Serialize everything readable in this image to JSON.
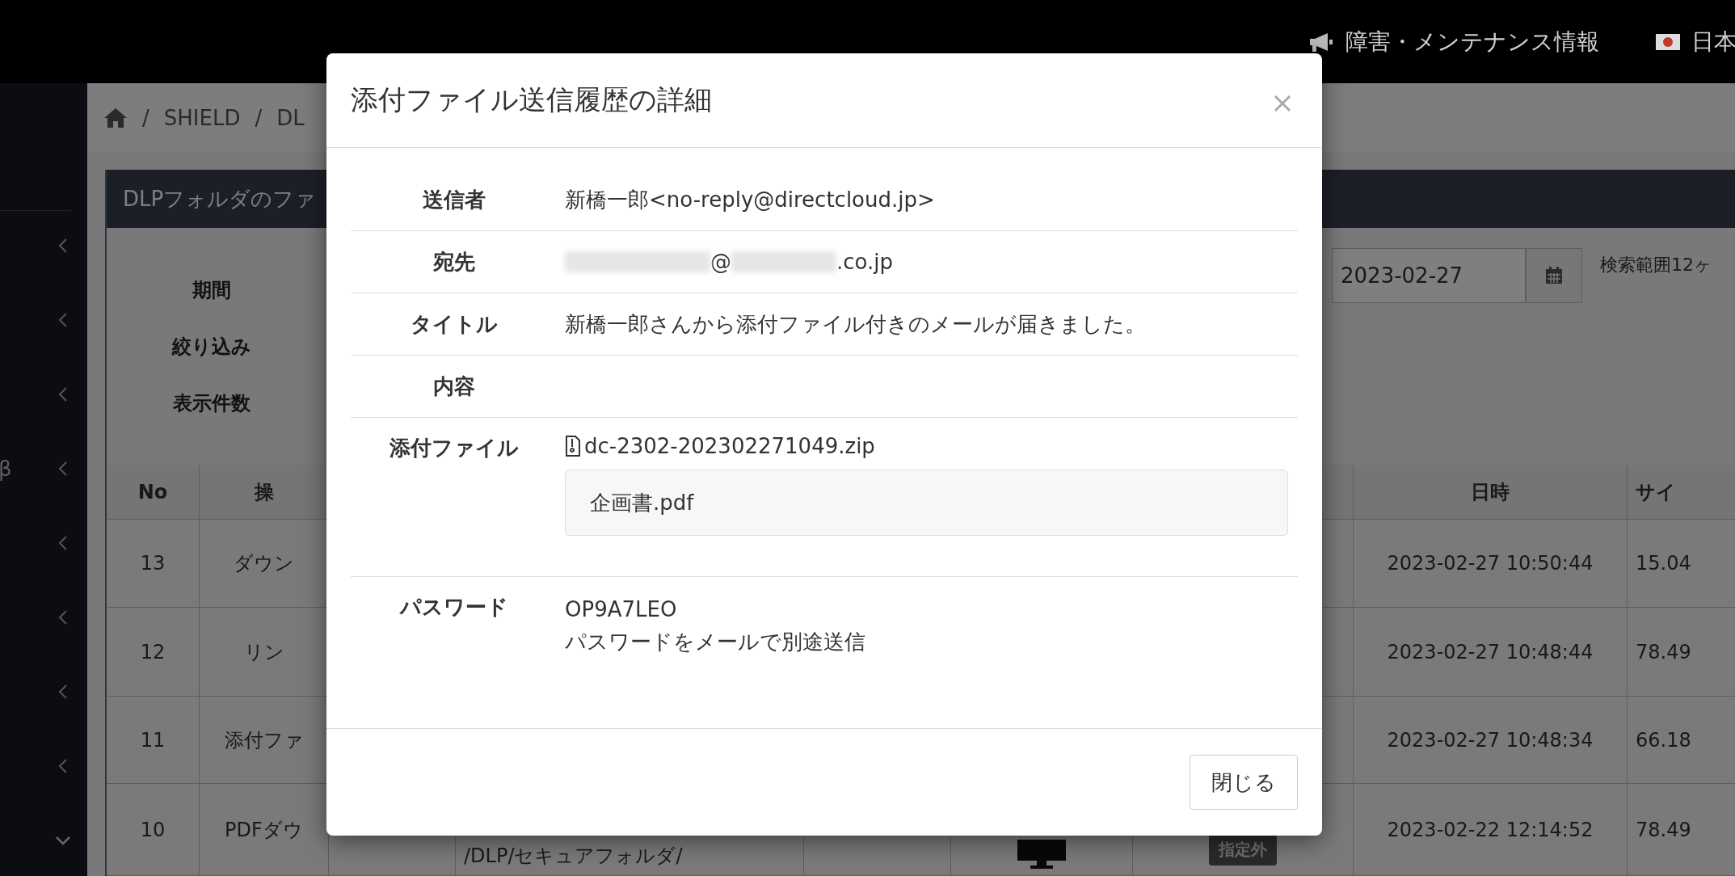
{
  "top_bar": {
    "notice_link": "障害・メンテナンス情報",
    "language": "日本"
  },
  "sidebar": {
    "beta_label": "β"
  },
  "breadcrumb": [
    {
      "kind": "home"
    },
    {
      "kind": "separator",
      "text": "/"
    },
    {
      "kind": "link",
      "text": "SHIELD"
    },
    {
      "kind": "separator",
      "text": "/"
    },
    {
      "kind": "link",
      "text": "DL"
    }
  ],
  "panel": {
    "title": "DLPフォルダのファ",
    "filters": [
      {
        "label": "期間"
      },
      {
        "label": "絞り込み"
      },
      {
        "label": "表示件数"
      }
    ],
    "date_to": "2023-02-27",
    "range_note": "検索範囲12ヶ"
  },
  "table": {
    "columns": [
      "No",
      "操",
      "日時",
      "サイ"
    ],
    "rows": [
      {
        "no": "13",
        "operation": "ダウン",
        "date": "2023-02-27 10:50:44",
        "size": "15.04"
      },
      {
        "no": "12",
        "operation": "リン",
        "date": "2023-02-27 10:48:44",
        "size": "78.49"
      },
      {
        "no": "11",
        "operation": "添付ファ",
        "date": "2023-02-27 10:48:34",
        "size": "66.18"
      },
      {
        "no": "10",
        "operation": "PDFダウ",
        "path": "/DLP/セキュアフォルダ/",
        "badge": "指定外",
        "date": "2023-02-22 12:14:52",
        "size": "78.49"
      }
    ]
  },
  "dialog": {
    "title": "添付ファイル送信履歴の詳細",
    "fields": [
      {
        "kind": "text",
        "label": "送信者",
        "value": "新橋一郎<no-reply@directcloud.jp>"
      },
      {
        "kind": "redacted",
        "label": "宛先",
        "parts": [
          {
            "kind": "redacted"
          },
          {
            "kind": "text",
            "text": "@"
          },
          {
            "kind": "redacted"
          },
          {
            "kind": "text",
            "text": ".co.jp"
          }
        ]
      },
      {
        "kind": "text",
        "label": "タイトル",
        "value": "新橋一郎さんから添付ファイル付きのメールが届きました。"
      },
      {
        "kind": "text",
        "label": "内容"
      },
      {
        "kind": "attachment",
        "label": "添付ファイル",
        "archive": "dc-2302-202302271049.zip",
        "files": [
          "企画書.pdf"
        ]
      },
      {
        "kind": "lines",
        "label": "パスワード",
        "lines": [
          "OP9A7LEO",
          "パスワードをメールで別途送信"
        ]
      }
    ],
    "close_button": "閉じる"
  }
}
